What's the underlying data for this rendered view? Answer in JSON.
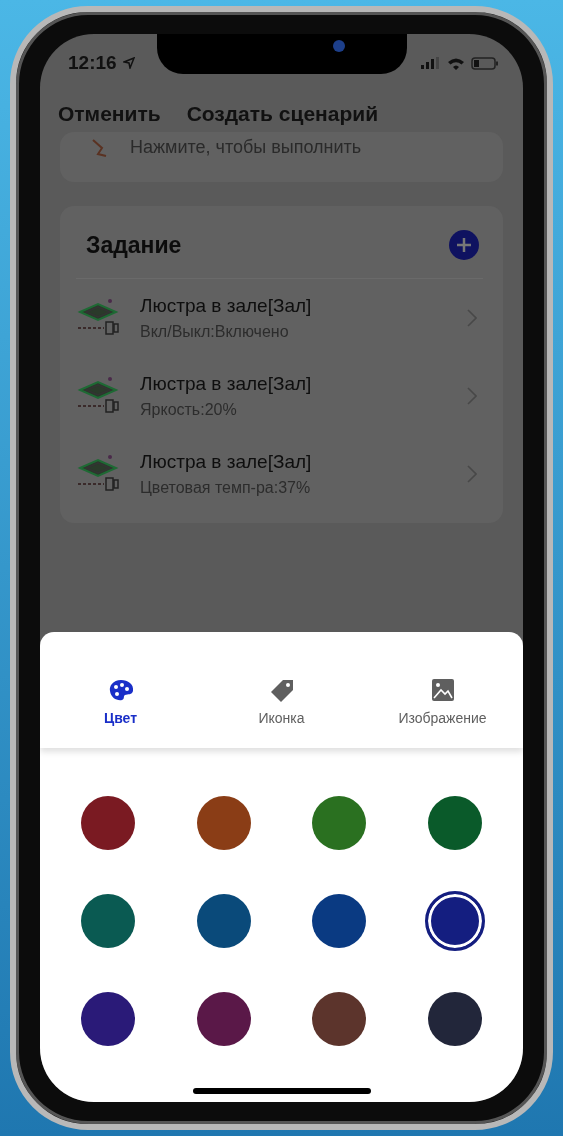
{
  "status_bar": {
    "time": "12:16"
  },
  "header": {
    "cancel": "Отменить",
    "title": "Создать сценарий"
  },
  "trigger_card": {
    "text": "Нажмите, чтобы выполнить"
  },
  "tasks": {
    "title": "Задание",
    "items": [
      {
        "name": "Люстра в зале[Зал]",
        "detail": "Вкл/Выкл:Включено"
      },
      {
        "name": "Люстра в зале[Зал]",
        "detail": "Яркость:20%"
      },
      {
        "name": "Люстра в зале[Зал]",
        "detail": "Цветовая темп-ра:37%"
      }
    ]
  },
  "sheet": {
    "tabs": [
      {
        "kind": "palette",
        "label": "Цвет",
        "selected": true
      },
      {
        "kind": "tag",
        "label": "Иконка",
        "selected": false
      },
      {
        "kind": "image",
        "label": "Изображение",
        "selected": false
      }
    ],
    "colors": [
      {
        "color": "#7a1a22",
        "selected": false
      },
      {
        "color": "#8a3d16",
        "selected": false
      },
      {
        "color": "#2a7020",
        "selected": false
      },
      {
        "color": "#0a5a2a",
        "selected": false
      },
      {
        "color": "#0a5a52",
        "selected": false
      },
      {
        "color": "#0a4a7a",
        "selected": false
      },
      {
        "color": "#0a3a82",
        "selected": false
      },
      {
        "color": "#141e80",
        "selected": true
      },
      {
        "color": "#2a1a78",
        "selected": false
      },
      {
        "color": "#5a1848",
        "selected": false
      },
      {
        "color": "#5c342c",
        "selected": false
      },
      {
        "color": "#22263a",
        "selected": false
      }
    ]
  }
}
